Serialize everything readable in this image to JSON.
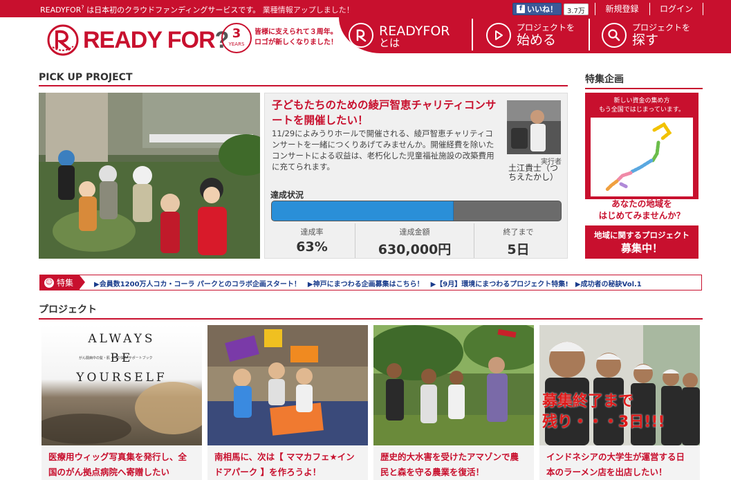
{
  "topbar": {
    "intro_text": "は日本初のクラウドファンディングサービスです。",
    "intro_brand": "READYFOR",
    "intro_brand_mark": "?",
    "intro_link": "業種情報アップしました！",
    "like_label": "いいね！",
    "like_count": "3.7万",
    "signup": "新規登録",
    "login": "ログイン"
  },
  "header": {
    "logo_main": "READY FOR",
    "logo_q": "?",
    "badge_number": "3",
    "badge_years": "YEARS",
    "anniversary_line1": "皆様に支えられて３周年。",
    "anniversary_line2": "ロゴが新しくなりました！",
    "nav": [
      {
        "line1": "READYFOR",
        "line2": "とは"
      },
      {
        "line1": "プロジェクトを",
        "line2": "始める"
      },
      {
        "line1": "プロジェクトを",
        "line2": "探す"
      }
    ]
  },
  "pickup": {
    "section_title": "PICK UP PROJECT",
    "title": "子どもたちのための綾戸智恵チャリティコンサートを開催したい！",
    "description": "11/29によみうりホールで開催される、綾戸智恵チャリティコンサートを一緒につくりあげてみませんか。開催経費を除いたコンサートによる収益は、老朽化した児童福祉施設の改築費用に充てられます。",
    "owner_role": "実行者",
    "owner_name": "土江貴士（つちえたかし）",
    "status_label": "達成状況",
    "progress_fraction": 0.63,
    "stats": [
      {
        "label": "達成率",
        "value": "63%"
      },
      {
        "label": "達成金額",
        "value": "630,000円"
      },
      {
        "label": "終了まで",
        "value": "5日"
      }
    ]
  },
  "feature": {
    "section_title": "特集企画",
    "top_line1": "新しい資金の集め方",
    "top_line2": "もう全国ではじまっています。",
    "question_line1": "あなたの地域を",
    "question_line2": "はじめてみませんか？",
    "bottom_line1": "地域に関するプロジェクト",
    "bottom_line2": "募集中！"
  },
  "ticker": {
    "label": "特集",
    "items": [
      "▶会員数1200万人コカ・コーラ パークとのコラボ企画スタート！",
      "▶神戸にまつわる企画募集はこちら！",
      "▶【9月】環境にまつわるプロジェクト特集!",
      "▶成功者の秘訣Vol.1"
    ]
  },
  "projects": {
    "section_title": "プロジェクト",
    "cards": [
      {
        "caption": "医療用ウィッグ写真集を発行し、全国のがん拠点病院へ寄贈したい",
        "img_words": [
          "ALWAYS",
          "BE",
          "YOURSELF"
        ],
        "img_sub": "がん闘病中の髪・肌・爪の悩み サポートブック"
      },
      {
        "caption": "南相馬に、次は【 ママカフェ★インドアパーク 】を作ろうよ！"
      },
      {
        "caption": "歴史的大水害を受けたアマゾンで農民と森を守る農業を復活！"
      },
      {
        "caption": "インドネシアの大学生が運営する日本のラーメン店を出店したい！",
        "img_overlay1": "募集終了まで",
        "img_overlay2": "残り・・・3日!!!"
      }
    ]
  },
  "colors": {
    "brand_red": "#c8102e",
    "progress_blue": "#2a8fd8",
    "link_blue": "#1a3c8c",
    "facebook_blue": "#3b5998"
  },
  "icons": [
    "readyfor-logo-icon",
    "play-icon",
    "search-icon",
    "smile-icon",
    "facebook-icon",
    "japan-map-icon"
  ]
}
